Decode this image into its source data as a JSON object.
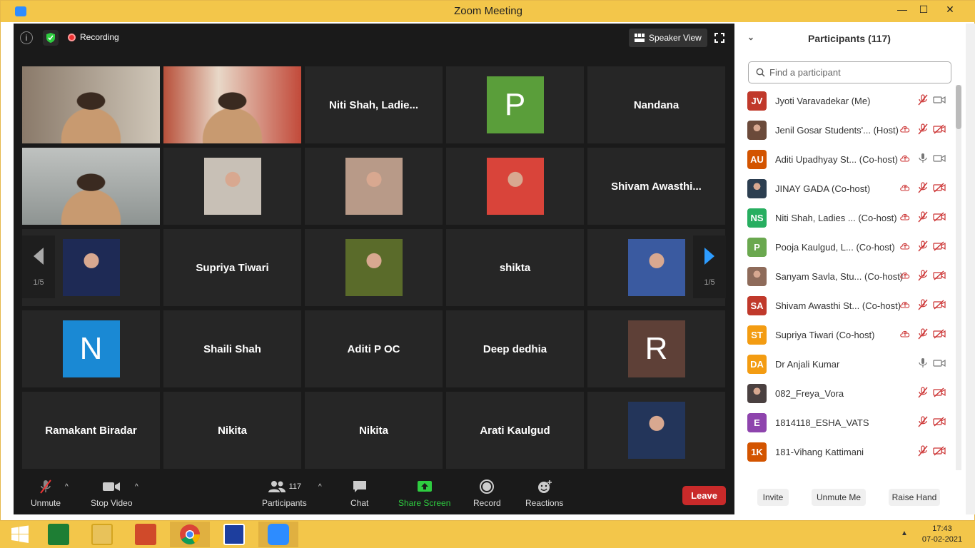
{
  "window": {
    "title": "Zoom Meeting",
    "minimize": "—",
    "maximize": "☐",
    "close": "✕"
  },
  "video_top": {
    "recording_label": "Recording",
    "speaker_view_label": "Speaker View"
  },
  "grid": {
    "rows": [
      [
        {
          "type": "video",
          "name": "woman-teal-saree"
        },
        {
          "type": "video",
          "name": "woman-orange"
        },
        {
          "type": "name",
          "label": "Niti  Shah,  Ladie..."
        },
        {
          "type": "avatar",
          "letter": "P",
          "color": "#5a9e3a"
        },
        {
          "type": "name",
          "label": "Nandana"
        }
      ],
      [
        {
          "type": "video",
          "name": "girl-active",
          "active": true
        },
        {
          "type": "photo",
          "name": "man-black-shirt"
        },
        {
          "type": "photo",
          "name": "boy-purple-shirt"
        },
        {
          "type": "photo",
          "name": "goddess-art"
        },
        {
          "type": "name",
          "label": "Shivam  Awasthi..."
        }
      ],
      [
        {
          "type": "photo",
          "name": "man-dark"
        },
        {
          "type": "name",
          "label": "Supriya Tiwari"
        },
        {
          "type": "photo",
          "name": "girl-yellow"
        },
        {
          "type": "name",
          "label": "shikta"
        },
        {
          "type": "photo",
          "name": "woman-blue"
        }
      ],
      [
        {
          "type": "avatar",
          "letter": "N",
          "color": "#1a89d4"
        },
        {
          "type": "name",
          "label": "Shaili Shah"
        },
        {
          "type": "name",
          "label": "Aditi P OC"
        },
        {
          "type": "name",
          "label": "Deep dedhia"
        },
        {
          "type": "avatar",
          "letter": "R",
          "color": "#5e4037"
        }
      ],
      [
        {
          "type": "name",
          "label": "Ramakant Biradar"
        },
        {
          "type": "name",
          "label": "Nikita"
        },
        {
          "type": "name",
          "label": "Nikita"
        },
        {
          "type": "name",
          "label": "Arati Kaulgud"
        },
        {
          "type": "photo",
          "name": "man-podium"
        }
      ]
    ],
    "page_left": "1/5",
    "page_right": "1/5"
  },
  "toolbar": {
    "unmute": "Unmute",
    "stop_video": "Stop Video",
    "participants": "Participants",
    "participants_count": "117",
    "chat": "Chat",
    "share_screen": "Share Screen",
    "record": "Record",
    "reactions": "Reactions",
    "leave": "Leave"
  },
  "panel": {
    "title": "Participants (117)",
    "search_placeholder": "Find a participant",
    "participants": [
      {
        "initials": "JV",
        "color": "#c0392b",
        "name": "Jyoti Varavadekar (Me)",
        "cloud": false,
        "mic": "muted",
        "cam": "on"
      },
      {
        "initials": "",
        "color": "#6b4a3a",
        "photo": true,
        "name": "Jenil Gosar Students'...  (Host)",
        "cloud": true,
        "mic": "muted",
        "cam": "off"
      },
      {
        "initials": "AU",
        "color": "#d35400",
        "name": "Aditi Upadhyay St...  (Co-host)",
        "cloud": true,
        "mic": "on",
        "cam": "on"
      },
      {
        "initials": "",
        "color": "#2c3e50",
        "photo": true,
        "name": "JINAY GADA (Co-host)",
        "cloud": true,
        "mic": "muted",
        "cam": "off"
      },
      {
        "initials": "NS",
        "color": "#27ae60",
        "name": "Niti Shah, Ladies ...  (Co-host)",
        "cloud": true,
        "mic": "muted",
        "cam": "off"
      },
      {
        "initials": "P",
        "color": "#6aa84f",
        "name": "Pooja Kaulgud, L...  (Co-host)",
        "cloud": true,
        "mic": "muted",
        "cam": "off"
      },
      {
        "initials": "",
        "color": "#8e6b5a",
        "photo": true,
        "name": "Sanyam Savla, Stu...  (Co-host)",
        "cloud": true,
        "mic": "muted",
        "cam": "off"
      },
      {
        "initials": "SA",
        "color": "#c0392b",
        "name": "Shivam Awasthi St...  (Co-host)",
        "cloud": true,
        "mic": "muted",
        "cam": "off"
      },
      {
        "initials": "ST",
        "color": "#f39c12",
        "name": "Supriya Tiwari (Co-host)",
        "cloud": true,
        "mic": "muted",
        "cam": "off"
      },
      {
        "initials": "DA",
        "color": "#f39c12",
        "name": "Dr Anjali Kumar",
        "cloud": false,
        "mic": "on",
        "cam": "on"
      },
      {
        "initials": "",
        "color": "#4a4040",
        "photo": true,
        "name": "082_Freya_Vora",
        "cloud": false,
        "mic": "muted",
        "cam": "off"
      },
      {
        "initials": "E",
        "color": "#8e44ad",
        "name": "1814118_ESHA_VATS",
        "cloud": false,
        "mic": "muted",
        "cam": "off"
      },
      {
        "initials": "1K",
        "color": "#d35400",
        "name": "181-Vihang Kattimani",
        "cloud": false,
        "mic": "muted",
        "cam": "off"
      }
    ],
    "invite": "Invite",
    "unmute_me": "Unmute Me",
    "raise_hand": "Raise Hand"
  },
  "taskbar": {
    "time": "17:43",
    "date": "07-02-2021",
    "apps": [
      "windows-start",
      "excel",
      "file-explorer",
      "powerpoint",
      "chrome",
      "isis",
      "zoom"
    ]
  }
}
